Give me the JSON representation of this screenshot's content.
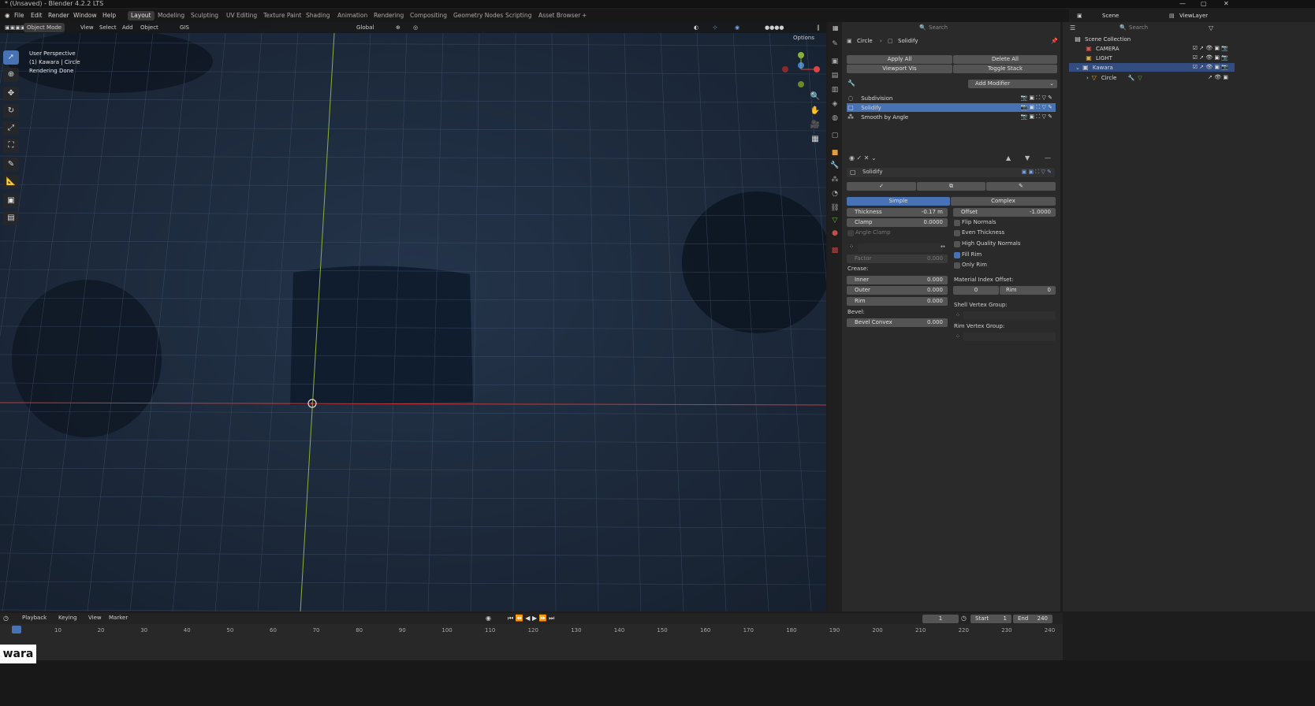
{
  "window": {
    "title": "* (Unsaved) - Blender 4.2.2 LTS"
  },
  "menu": [
    "File",
    "Edit",
    "Render",
    "Window",
    "Help"
  ],
  "workspaces": [
    "Layout",
    "Modeling",
    "Sculpting",
    "UV Editing",
    "Texture Paint",
    "Shading",
    "Animation",
    "Rendering",
    "Compositing",
    "Geometry Nodes",
    "Scripting",
    "Asset Browser"
  ],
  "viewport": {
    "mode": "Object Mode",
    "menu": [
      "View",
      "Select",
      "Add",
      "Object"
    ],
    "gis_label": "GIS",
    "transform": "Global",
    "options_label": "Options",
    "overlay_lines": [
      "User Perspective",
      "(1) Kawara | Circle",
      "Rendering Done"
    ]
  },
  "properties": {
    "breadcrumb": {
      "object": "Circle",
      "modifier": "Solidify"
    },
    "search_placeholder": "Search",
    "apply_label": "Apply All",
    "delete_all_label": "Delete All",
    "viewport_vis_label": "Viewport Vis",
    "toggle_stack_label": "Toggle Stack",
    "add_modifier_label": "Add Modifier",
    "modifiers": [
      "Subdivision",
      "Solidify",
      "Smooth by Angle"
    ],
    "active_modifier": "Solidify",
    "mode_simple": "Simple",
    "mode_complex": "Complex",
    "thickness_label": "Thickness",
    "thickness_value": "-0.17 m",
    "offset_label": "Offset",
    "offset_value": "-1.0000",
    "clamp_label": "Clamp",
    "clamp_value": "0.0000",
    "angle_clamp_label": "Angle Clamp",
    "factor_label": "Factor",
    "factor_value": "0.000",
    "flip_normals": "Flip Normals",
    "even_thickness": "Even Thickness",
    "high_quality_normals": "High Quality Normals",
    "fill_rim": "Fill Rim",
    "only_rim": "Only Rim",
    "crease_label": "Crease:",
    "inner_label": "Inner",
    "inner_value": "0.000",
    "outer_label": "Outer",
    "outer_value": "0.000",
    "rim_label": "Rim",
    "rim_value": "0.000",
    "bevel_label": "Bevel:",
    "bevel_convex_label": "Bevel Convex",
    "bevel_convex_value": "0.000",
    "material_index_offset_label": "Material Index Offset:",
    "mat_value": "0",
    "mat_rim_label": "Rim",
    "mat_rim_value": "0",
    "shell_vertex_group_label": "Shell Vertex Group:",
    "rim_vertex_group_label": "Rim Vertex Group:"
  },
  "outliner": {
    "scene_label": "Scene",
    "viewlayer_label": "ViewLayer",
    "search_placeholder": "Search",
    "root": "Scene Collection",
    "items": [
      "CAMERA",
      "LIGHT",
      "Kawara",
      "Circle"
    ]
  },
  "timeline": {
    "menu": [
      "Playback",
      "Keying",
      "View",
      "Marker"
    ],
    "current_frame": "1",
    "start_label": "Start",
    "start_value": "1",
    "end_label": "End",
    "end_value": "240",
    "ticks": [
      "1",
      "10",
      "20",
      "30",
      "40",
      "50",
      "60",
      "70",
      "80",
      "90",
      "100",
      "110",
      "120",
      "130",
      "140",
      "150",
      "160",
      "170",
      "180",
      "190",
      "200",
      "210",
      "220",
      "230",
      "240"
    ]
  },
  "watermark": "wara",
  "colors": {
    "accent": "#4772b3",
    "viewport_bg": "#1c2a3c",
    "x_axis": "#c23a3a",
    "y_axis": "#8ab03a"
  }
}
